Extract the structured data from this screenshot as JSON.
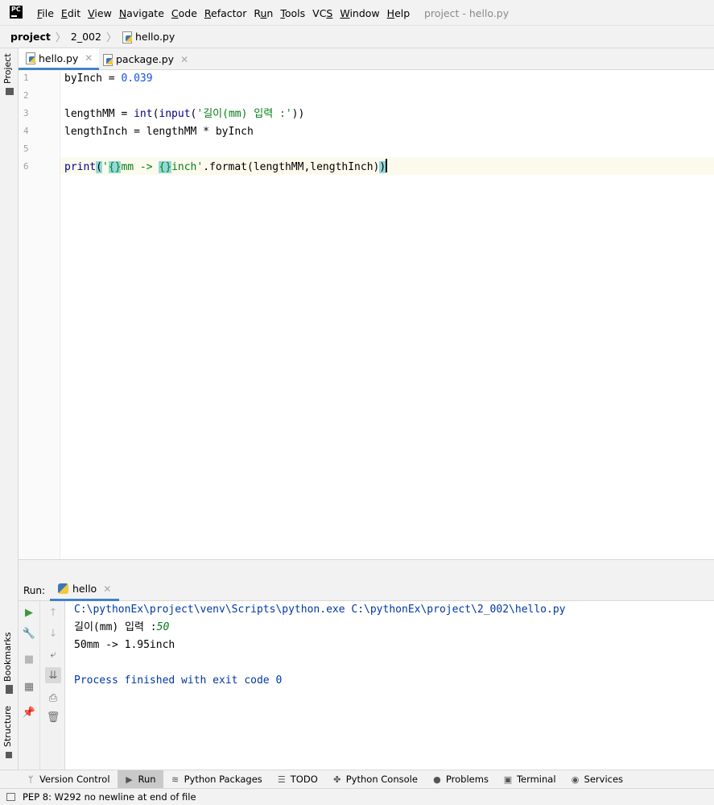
{
  "menubar": {
    "items": [
      "File",
      "Edit",
      "View",
      "Navigate",
      "Code",
      "Refactor",
      "Run",
      "Tools",
      "VCS",
      "Window",
      "Help"
    ],
    "mnemonics": [
      "F",
      "E",
      "V",
      "N",
      "C",
      "R",
      "u",
      "T",
      "S",
      "W",
      "H"
    ],
    "window_title": "project - hello.py",
    "logo": "PC"
  },
  "navbar": {
    "crumbs": [
      "project",
      "2_002",
      "hello.py"
    ]
  },
  "left_strip": {
    "project_label": "Project",
    "bookmarks_label": "Bookmarks",
    "structure_label": "Structure"
  },
  "editor_tabs": [
    {
      "label": "hello.py",
      "active": true
    },
    {
      "label": "package.py",
      "active": false
    }
  ],
  "editor": {
    "line_numbers": [
      "1",
      "2",
      "3",
      "4",
      "5",
      "6"
    ],
    "lines": [
      {
        "a": "byInch = ",
        "b": "0.039"
      },
      {},
      {
        "a": "lengthMM = ",
        "b": "int",
        "c": "(",
        "d": "input",
        "e": "(",
        "f": "'길이(mm) 입력 :'",
        "g": "))"
      },
      {
        "a": "lengthInch = lengthMM * byInch"
      },
      {},
      {
        "a": "print",
        "b": "(",
        "c": "'",
        "d": "{}",
        "e": "mm -> ",
        "f": "{}",
        "g": "inch'",
        "h": ".format(lengthMM,lengthInch)",
        "i": ")"
      }
    ]
  },
  "run": {
    "label": "Run:",
    "tab": "hello",
    "console": {
      "command": "C:\\pythonEx\\project\\venv\\Scripts\\python.exe C:\\pythonEx\\project\\2_002\\hello.py",
      "prompt": "길이(mm) 입력 :",
      "input": "50",
      "output": "50mm -> 1.95inch",
      "exit": "Process finished with exit code 0"
    }
  },
  "bottom_tabs": [
    "Version Control",
    "Run",
    "Python Packages",
    "TODO",
    "Python Console",
    "Problems",
    "Terminal",
    "Services"
  ],
  "bottom_tab_icons": [
    "branch-icon",
    "play-icon",
    "layers-icon",
    "list-icon",
    "python-icon",
    "info-icon",
    "terminal-icon",
    "services-icon"
  ],
  "active_bottom_tab": "Run",
  "status": {
    "message": "PEP 8: W292 no newline at end of file"
  },
  "colors": {
    "active_tab_underline": "#4083c9",
    "number": "#1750eb",
    "string": "#067d17",
    "builtin": "#000080",
    "console_system": "#0037a6",
    "caret_line": "#fcfaed",
    "brace_match": "#93d9d9"
  }
}
